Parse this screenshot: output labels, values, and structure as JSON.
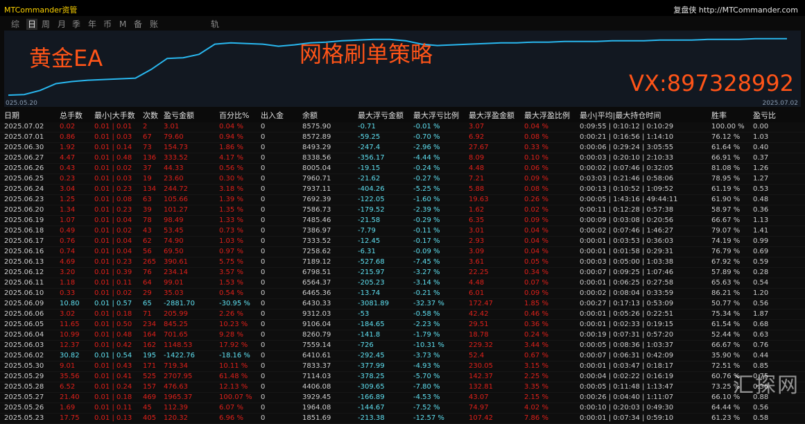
{
  "titlebar": {
    "app": "MTCommander资管",
    "link": "复盘侠 http://MTCommander.com"
  },
  "tabs": [
    "综",
    "日",
    "周",
    "月",
    "季",
    "年",
    "币",
    "M",
    "备",
    "账户"
  ],
  "active_tab": "日",
  "track_label": "轨迹",
  "chart": {
    "overlay_left": "黄金EA",
    "overlay_center": "网格刷单策略",
    "overlay_right": "VX:897328992",
    "date_start": "025.05.20",
    "date_end": "2025.07.02",
    "line_color": "#29b8f0",
    "points": [
      0.07,
      0.08,
      0.14,
      0.24,
      0.27,
      0.29,
      0.3,
      0.31,
      0.32,
      0.45,
      0.61,
      0.62,
      0.67,
      0.82,
      0.84,
      0.83,
      0.82,
      0.79,
      0.81,
      0.84,
      0.85,
      0.87,
      0.88,
      0.89,
      0.89,
      0.87,
      0.82,
      0.8,
      0.81,
      0.82,
      0.83,
      0.84,
      0.84,
      0.85,
      0.85,
      0.86,
      0.86,
      0.86,
      0.87,
      0.87,
      0.87,
      0.88,
      0.88,
      0.88,
      0.89,
      0.89,
      0.89,
      0.9,
      0.9,
      0.9
    ]
  },
  "columns": [
    "日期",
    "总手数",
    "最小|大手数",
    "次数",
    "盈亏金额",
    "百分比%",
    "出入金",
    "余额",
    "最大浮亏金额",
    "最大浮亏比例",
    "最大浮盈金额",
    "最大浮盈比例",
    "最小|平均|最大持仓时间",
    "胜率",
    "盈亏比"
  ],
  "rows": [
    {
      "date": "2025.07.02",
      "lots": "0.02",
      "minmax": "0.01 | 0.01",
      "count": "2",
      "pnl": "3.01",
      "pct": "0.04 %",
      "io": "0",
      "balance": "8575.90",
      "maxdd": "-0.71",
      "maxddp": "-0.01 %",
      "maxfp": "3.07",
      "maxfpp": "0.04 %",
      "hold": "0:09:55 | 0:10:12 | 0:10:29",
      "win": "100.00 %",
      "ratio": "0.00"
    },
    {
      "date": "2025.07.01",
      "lots": "0.86",
      "minmax": "0.01 | 0.03",
      "count": "67",
      "pnl": "79.60",
      "pct": "0.94 %",
      "io": "0",
      "balance": "8572.89",
      "maxdd": "-59.25",
      "maxddp": "-0.70 %",
      "maxfp": "6.92",
      "maxfpp": "0.08 %",
      "hold": "0:00:21 | 0:16:56 | 1:14:10",
      "win": "76.12 %",
      "ratio": "1.03"
    },
    {
      "date": "2025.06.30",
      "lots": "1.92",
      "minmax": "0.01 | 0.14",
      "count": "73",
      "pnl": "154.73",
      "pct": "1.86 %",
      "io": "0",
      "balance": "8493.29",
      "maxdd": "-247.4",
      "maxddp": "-2.96 %",
      "maxfp": "27.67",
      "maxfpp": "0.33 %",
      "hold": "0:00:06 | 0:29:24 | 3:05:55",
      "win": "61.64 %",
      "ratio": "0.40"
    },
    {
      "date": "2025.06.27",
      "lots": "4.47",
      "minmax": "0.01 | 0.48",
      "count": "136",
      "pnl": "333.52",
      "pct": "4.17 %",
      "io": "0",
      "balance": "8338.56",
      "maxdd": "-356.17",
      "maxddp": "-4.44 %",
      "maxfp": "8.09",
      "maxfpp": "0.10 %",
      "hold": "0:00:03 | 0:20:10 | 2:10:33",
      "win": "66.91 %",
      "ratio": "0.37"
    },
    {
      "date": "2025.06.26",
      "lots": "0.43",
      "minmax": "0.01 | 0.02",
      "count": "37",
      "pnl": "44.33",
      "pct": "0.56 %",
      "io": "0",
      "balance": "8005.04",
      "maxdd": "-19.15",
      "maxddp": "-0.24 %",
      "maxfp": "4.48",
      "maxfpp": "0.06 %",
      "hold": "0:00:02 | 0:07:46 | 0:32:05",
      "win": "81.08 %",
      "ratio": "1.26"
    },
    {
      "date": "2025.06.25",
      "lots": "0.23",
      "minmax": "0.01 | 0.03",
      "count": "19",
      "pnl": "23.60",
      "pct": "0.30 %",
      "io": "0",
      "balance": "7960.71",
      "maxdd": "-21.62",
      "maxddp": "-0.27 %",
      "maxfp": "7.21",
      "maxfpp": "0.09 %",
      "hold": "0:03:03 | 0:21:46 | 0:58:06",
      "win": "78.95 %",
      "ratio": "1.27"
    },
    {
      "date": "2025.06.24",
      "lots": "3.04",
      "minmax": "0.01 | 0.23",
      "count": "134",
      "pnl": "244.72",
      "pct": "3.18 %",
      "io": "0",
      "balance": "7937.11",
      "maxdd": "-404.26",
      "maxddp": "-5.25 %",
      "maxfp": "5.88",
      "maxfpp": "0.08 %",
      "hold": "0:00:13 | 0:10:52 | 1:09:52",
      "win": "61.19 %",
      "ratio": "0.53"
    },
    {
      "date": "2025.06.23",
      "lots": "1.25",
      "minmax": "0.01 | 0.08",
      "count": "63",
      "pnl": "105.66",
      "pct": "1.39 %",
      "io": "0",
      "balance": "7692.39",
      "maxdd": "-122.05",
      "maxddp": "-1.60 %",
      "maxfp": "19.63",
      "maxfpp": "0.26 %",
      "hold": "0:00:05 | 1:43:16 | 49:44:11",
      "win": "61.90 %",
      "ratio": "0.48"
    },
    {
      "date": "2025.06.20",
      "lots": "1.34",
      "minmax": "0.01 | 0.23",
      "count": "39",
      "pnl": "101.27",
      "pct": "1.35 %",
      "io": "0",
      "balance": "7586.73",
      "maxdd": "-179.52",
      "maxddp": "-2.39 %",
      "maxfp": "1.62",
      "maxfpp": "0.02 %",
      "hold": "0:00:11 | 0:12:28 | 0:57:38",
      "win": "58.97 %",
      "ratio": "0.36"
    },
    {
      "date": "2025.06.19",
      "lots": "1.07",
      "minmax": "0.01 | 0.04",
      "count": "78",
      "pnl": "98.49",
      "pct": "1.33 %",
      "io": "0",
      "balance": "7485.46",
      "maxdd": "-21.58",
      "maxddp": "-0.29 %",
      "maxfp": "6.35",
      "maxfpp": "0.09 %",
      "hold": "0:00:09 | 0:03:08 | 0:20:56",
      "win": "66.67 %",
      "ratio": "1.13"
    },
    {
      "date": "2025.06.18",
      "lots": "0.49",
      "minmax": "0.01 | 0.02",
      "count": "43",
      "pnl": "53.45",
      "pct": "0.73 %",
      "io": "0",
      "balance": "7386.97",
      "maxdd": "-7.79",
      "maxddp": "-0.11 %",
      "maxfp": "3.01",
      "maxfpp": "0.04 %",
      "hold": "0:00:02 | 0:07:46 | 1:46:27",
      "win": "79.07 %",
      "ratio": "1.41"
    },
    {
      "date": "2025.06.17",
      "lots": "0.76",
      "minmax": "0.01 | 0.04",
      "count": "62",
      "pnl": "74.90",
      "pct": "1.03 %",
      "io": "0",
      "balance": "7333.52",
      "maxdd": "-12.45",
      "maxddp": "-0.17 %",
      "maxfp": "2.93",
      "maxfpp": "0.04 %",
      "hold": "0:00:01 | 0:03:53 | 0:36:03",
      "win": "74.19 %",
      "ratio": "0.99"
    },
    {
      "date": "2025.06.16",
      "lots": "0.74",
      "minmax": "0.01 | 0.04",
      "count": "56",
      "pnl": "69.50",
      "pct": "0.97 %",
      "io": "0",
      "balance": "7258.62",
      "maxdd": "-6.31",
      "maxddp": "-0.09 %",
      "maxfp": "3.09",
      "maxfpp": "0.04 %",
      "hold": "0:00:01 | 0:01:58 | 0:29:31",
      "win": "76.79 %",
      "ratio": "0.69"
    },
    {
      "date": "2025.06.13",
      "lots": "4.69",
      "minmax": "0.01 | 0.23",
      "count": "265",
      "pnl": "390.61",
      "pct": "5.75 %",
      "io": "0",
      "balance": "7189.12",
      "maxdd": "-527.68",
      "maxddp": "-7.45 %",
      "maxfp": "3.61",
      "maxfpp": "0.05 %",
      "hold": "0:00:03 | 0:05:00 | 1:03:38",
      "win": "67.92 %",
      "ratio": "0.59"
    },
    {
      "date": "2025.06.12",
      "lots": "3.20",
      "minmax": "0.01 | 0.39",
      "count": "76",
      "pnl": "234.14",
      "pct": "3.57 %",
      "io": "0",
      "balance": "6798.51",
      "maxdd": "-215.97",
      "maxddp": "-3.27 %",
      "maxfp": "22.25",
      "maxfpp": "0.34 %",
      "hold": "0:00:07 | 0:09:25 | 1:07:46",
      "win": "57.89 %",
      "ratio": "0.28"
    },
    {
      "date": "2025.06.11",
      "lots": "1.18",
      "minmax": "0.01 | 0.11",
      "count": "64",
      "pnl": "99.01",
      "pct": "1.53 %",
      "io": "0",
      "balance": "6564.37",
      "maxdd": "-205.23",
      "maxddp": "-3.14 %",
      "maxfp": "4.48",
      "maxfpp": "0.07 %",
      "hold": "0:00:01 | 0:06:25 | 0:27:58",
      "win": "65.63 %",
      "ratio": "0.54"
    },
    {
      "date": "2025.06.10",
      "lots": "0.33",
      "minmax": "0.01 | 0.02",
      "count": "29",
      "pnl": "35.03",
      "pct": "0.54 %",
      "io": "0",
      "balance": "6465.36",
      "maxdd": "-13.74",
      "maxddp": "-0.21 %",
      "maxfp": "6.01",
      "maxfpp": "0.09 %",
      "hold": "0:00:02 | 0:08:04 | 0:33:59",
      "win": "86.21 %",
      "ratio": "1.20"
    },
    {
      "date": "2025.06.09",
      "lots": "10.80",
      "minmax": "0.01 | 0.57",
      "count": "65",
      "pnl": "-2881.70",
      "pct": "-30.95 %",
      "io": "0",
      "balance": "6430.33",
      "maxdd": "-3081.89",
      "maxddp": "-32.37 %",
      "maxfp": "172.47",
      "maxfpp": "1.85 %",
      "hold": "0:00:27 | 0:17:13 | 0:53:09",
      "win": "50.77 %",
      "ratio": "0.56",
      "loss": true
    },
    {
      "date": "2025.06.06",
      "lots": "3.02",
      "minmax": "0.01 | 0.18",
      "count": "71",
      "pnl": "205.99",
      "pct": "2.26 %",
      "io": "0",
      "balance": "9312.03",
      "maxdd": "-53",
      "maxddp": "-0.58 %",
      "maxfp": "42.42",
      "maxfpp": "0.46 %",
      "hold": "0:00:01 | 0:05:26 | 0:22:51",
      "win": "75.34 %",
      "ratio": "1.87"
    },
    {
      "date": "2025.06.05",
      "lots": "11.65",
      "minmax": "0.01 | 0.50",
      "count": "234",
      "pnl": "845.25",
      "pct": "10.23 %",
      "io": "0",
      "balance": "9106.04",
      "maxdd": "-184.65",
      "maxddp": "-2.23 %",
      "maxfp": "29.51",
      "maxfpp": "0.36 %",
      "hold": "0:00:01 | 0:02:33 | 0:19:15",
      "win": "61.54 %",
      "ratio": "0.68"
    },
    {
      "date": "2025.06.04",
      "lots": "10.99",
      "minmax": "0.01 | 0.48",
      "count": "164",
      "pnl": "701.65",
      "pct": "9.28 %",
      "io": "0",
      "balance": "8260.79",
      "maxdd": "-141.8",
      "maxddp": "-1.79 %",
      "maxfp": "18.78",
      "maxfpp": "0.24 %",
      "hold": "0:00:19 | 0:07:31 | 0:57:20",
      "win": "52.44 %",
      "ratio": "0.63"
    },
    {
      "date": "2025.06.03",
      "lots": "12.37",
      "minmax": "0.01 | 0.42",
      "count": "162",
      "pnl": "1148.53",
      "pct": "17.92 %",
      "io": "0",
      "balance": "7559.14",
      "maxdd": "-726",
      "maxddp": "-10.31 %",
      "maxfp": "229.32",
      "maxfpp": "3.44 %",
      "hold": "0:00:05 | 0:08:36 | 1:03:37",
      "win": "66.67 %",
      "ratio": "0.76"
    },
    {
      "date": "2025.06.02",
      "lots": "30.82",
      "minmax": "0.01 | 0.54",
      "count": "195",
      "pnl": "-1422.76",
      "pct": "-18.16 %",
      "io": "0",
      "balance": "6410.61",
      "maxdd": "-292.45",
      "maxddp": "-3.73 %",
      "maxfp": "52.4",
      "maxfpp": "0.67 %",
      "hold": "0:00:07 | 0:06:31 | 0:42:09",
      "win": "35.90 %",
      "ratio": "0.44",
      "loss": true
    },
    {
      "date": "2025.05.30",
      "lots": "9.01",
      "minmax": "0.01 | 0.43",
      "count": "171",
      "pnl": "719.34",
      "pct": "10.11 %",
      "io": "0",
      "balance": "7833.37",
      "maxdd": "-377.99",
      "maxddp": "-4.93 %",
      "maxfp": "230.05",
      "maxfpp": "3.15 %",
      "hold": "0:00:01 | 0:03:47 | 0:18:17",
      "win": "72.51 %",
      "ratio": "0.85"
    },
    {
      "date": "2025.05.29",
      "lots": "35.56",
      "minmax": "0.01 | 0.41",
      "count": "525",
      "pnl": "2707.95",
      "pct": "61.48 %",
      "io": "0",
      "balance": "7114.03",
      "maxdd": "-378.25",
      "maxddp": "-5.70 %",
      "maxfp": "142.37",
      "maxfpp": "2.25 %",
      "hold": "0:00:04 | 0:02:22 | 0:16:19",
      "win": "60.76 %",
      "ratio": "0.75"
    },
    {
      "date": "2025.05.28",
      "lots": "6.52",
      "minmax": "0.01 | 0.24",
      "count": "157",
      "pnl": "476.63",
      "pct": "12.13 %",
      "io": "0",
      "balance": "4406.08",
      "maxdd": "-309.65",
      "maxddp": "-7.80 %",
      "maxfp": "132.81",
      "maxfpp": "3.35 %",
      "hold": "0:00:05 | 0:11:48 | 1:13:47",
      "win": "73.25 %",
      "ratio": "0.36"
    },
    {
      "date": "2025.05.27",
      "lots": "21.40",
      "minmax": "0.01 | 0.18",
      "count": "469",
      "pnl": "1965.37",
      "pct": "100.07 %",
      "io": "0",
      "balance": "3929.45",
      "maxdd": "-166.89",
      "maxddp": "-4.53 %",
      "maxfp": "43.07",
      "maxfpp": "2.15 %",
      "hold": "0:00:26 | 0:04:40 | 1:11:07",
      "win": "66.10 %",
      "ratio": "0.88"
    },
    {
      "date": "2025.05.26",
      "lots": "1.69",
      "minmax": "0.01 | 0.11",
      "count": "45",
      "pnl": "112.39",
      "pct": "6.07 %",
      "io": "0",
      "balance": "1964.08",
      "maxdd": "-144.67",
      "maxddp": "-7.52 %",
      "maxfp": "74.97",
      "maxfpp": "4.02 %",
      "hold": "0:00:10 | 0:20:03 | 0:49:30",
      "win": "64.44 %",
      "ratio": "0.56"
    },
    {
      "date": "2025.05.23",
      "lots": "17.75",
      "minmax": "0.01 | 0.13",
      "count": "405",
      "pnl": "120.32",
      "pct": "6.96 %",
      "io": "0",
      "balance": "1851.69",
      "maxdd": "-213.38",
      "maxddp": "-12.57 %",
      "maxfp": "107.42",
      "maxfpp": "7.86 %",
      "hold": "0:00:01 | 0:07:34 | 0:59:10",
      "win": "61.23 %",
      "ratio": "0.58"
    }
  ],
  "watermark": "汇探网"
}
